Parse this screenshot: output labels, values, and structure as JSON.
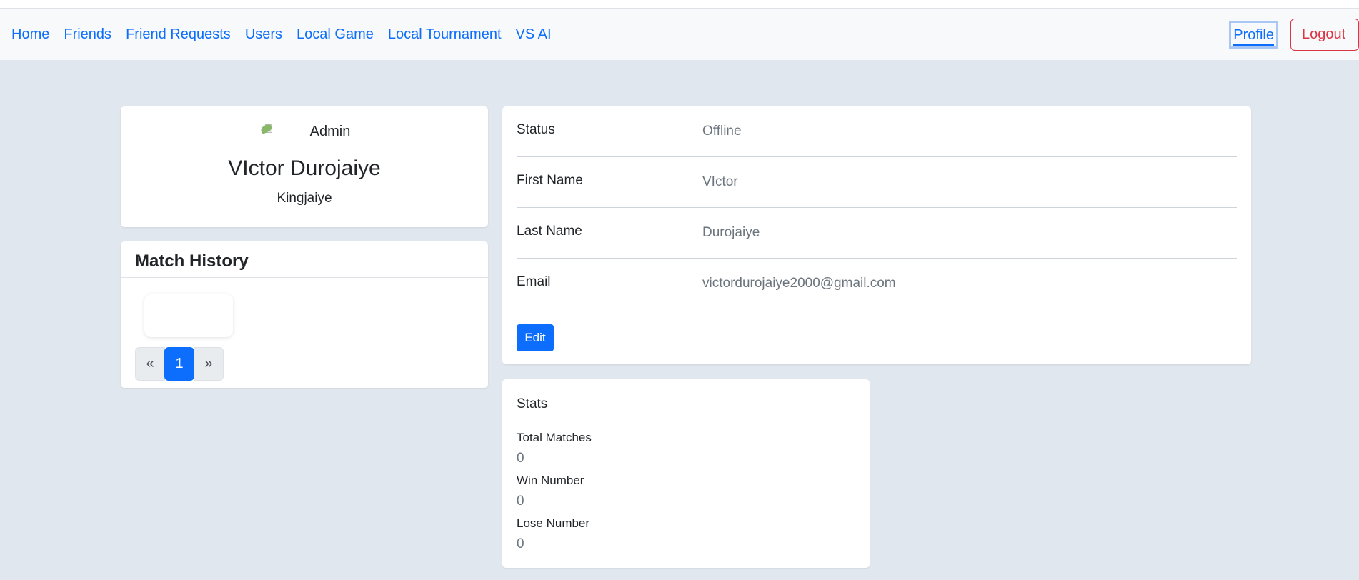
{
  "nav": {
    "links": [
      "Home",
      "Friends",
      "Friend Requests",
      "Users",
      "Local Game",
      "Local Tournament",
      "VS AI"
    ],
    "profile": "Profile",
    "logout": "Logout"
  },
  "profile": {
    "avatar_alt": "Admin",
    "full_name": "VIctor Durojaiye",
    "username": "Kingjaiye"
  },
  "match_history": {
    "title": "Match History",
    "pagination": {
      "prev": "«",
      "current": "1",
      "next": "»"
    }
  },
  "info": {
    "rows": [
      {
        "label": "Status",
        "value": "Offline"
      },
      {
        "label": "First Name",
        "value": "VIctor"
      },
      {
        "label": "Last Name",
        "value": "Durojaiye"
      },
      {
        "label": "Email",
        "value": "victordurojaiye2000@gmail.com"
      }
    ],
    "edit_label": "Edit"
  },
  "stats": {
    "title": "Stats",
    "items": [
      {
        "label": "Total Matches",
        "value": "0"
      },
      {
        "label": "Win Number",
        "value": "0"
      },
      {
        "label": "Lose Number",
        "value": "0"
      }
    ]
  },
  "colors": {
    "primary": "#0d6efd",
    "danger": "#dc3545",
    "page_bg": "#e1e7ef",
    "navbar_bg": "#f8f9fa",
    "muted_text": "#6c757d"
  }
}
